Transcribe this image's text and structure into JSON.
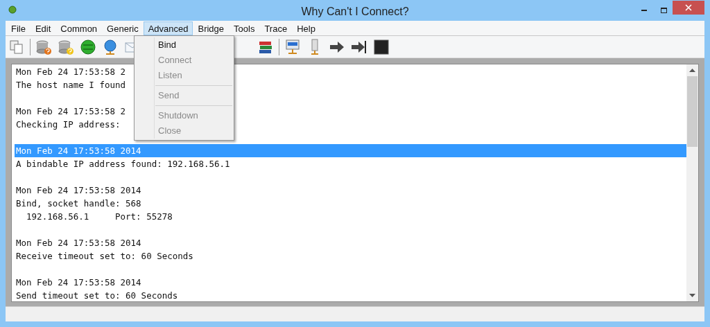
{
  "window": {
    "title": "Why Can't I Connect?"
  },
  "menu_bar": [
    {
      "label": "File",
      "selected": false
    },
    {
      "label": "Edit",
      "selected": false
    },
    {
      "label": "Common",
      "selected": false
    },
    {
      "label": "Generic",
      "selected": false
    },
    {
      "label": "Advanced",
      "selected": true
    },
    {
      "label": "Bridge",
      "selected": false
    },
    {
      "label": "Tools",
      "selected": false
    },
    {
      "label": "Trace",
      "selected": false
    },
    {
      "label": "Help",
      "selected": false
    }
  ],
  "dropdown_menu": [
    {
      "kind": "item",
      "label": "Bind",
      "disabled": false
    },
    {
      "kind": "item",
      "label": "Connect",
      "disabled": true
    },
    {
      "kind": "item",
      "label": "Listen",
      "disabled": true
    },
    {
      "kind": "separator"
    },
    {
      "kind": "item",
      "label": "Send",
      "disabled": true
    },
    {
      "kind": "separator"
    },
    {
      "kind": "item",
      "label": "Shutdown",
      "disabled": true
    },
    {
      "kind": "item",
      "label": "Close",
      "disabled": true
    }
  ],
  "log": [
    {
      "lines": [
        {
          "text": "Mon Feb 24 17:53:58 2",
          "selected": false
        },
        {
          "text": "The host name I found",
          "selected": false
        }
      ]
    },
    {
      "lines": [
        {
          "text": "Mon Feb 24 17:53:58 2",
          "selected": false
        },
        {
          "text": "Checking IP address:",
          "selected": false
        }
      ]
    },
    {
      "lines": [
        {
          "text": "Mon Feb 24 17:53:58 2014",
          "selected": true
        },
        {
          "text": "A bindable IP address found: 192.168.56.1",
          "selected": false
        }
      ]
    },
    {
      "lines": [
        {
          "text": "Mon Feb 24 17:53:58 2014",
          "selected": false
        },
        {
          "text": "Bind, socket handle: 568",
          "selected": false
        },
        {
          "text": "  192.168.56.1     Port: 55278",
          "selected": false
        }
      ]
    },
    {
      "lines": [
        {
          "text": "Mon Feb 24 17:53:58 2014",
          "selected": false
        },
        {
          "text": "Receive timeout set to: 60 Seconds",
          "selected": false
        }
      ]
    },
    {
      "lines": [
        {
          "text": "Mon Feb 24 17:53:58 2014",
          "selected": false
        },
        {
          "text": "Send timeout set to: 60 Seconds",
          "selected": false
        }
      ]
    }
  ]
}
